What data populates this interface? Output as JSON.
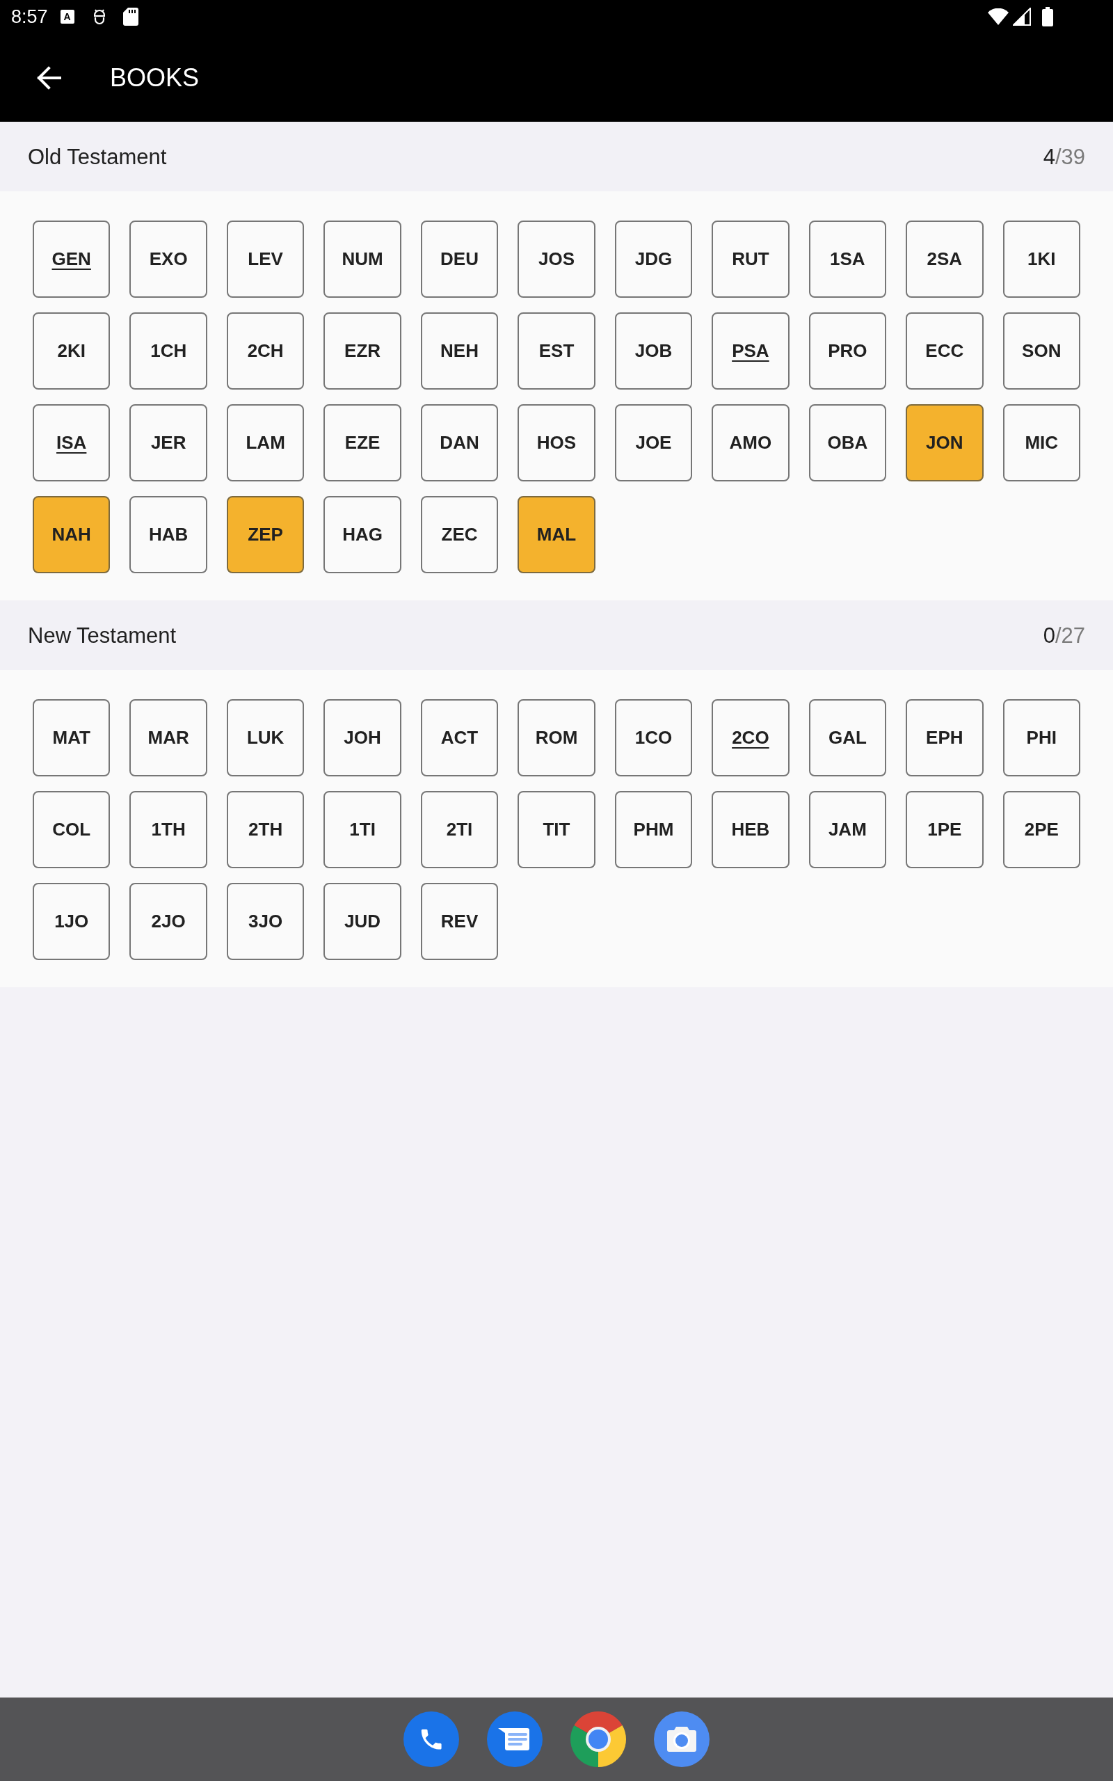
{
  "status_bar": {
    "time": "8:57",
    "badge_letter": "A"
  },
  "app_bar": {
    "title": "BOOKS"
  },
  "sections": [
    {
      "title": "Old Testament",
      "count": "4",
      "total": "/39",
      "books": [
        {
          "label": "GEN",
          "selected": false,
          "underlined": true
        },
        {
          "label": "EXO",
          "selected": false,
          "underlined": false
        },
        {
          "label": "LEV",
          "selected": false,
          "underlined": false
        },
        {
          "label": "NUM",
          "selected": false,
          "underlined": false
        },
        {
          "label": "DEU",
          "selected": false,
          "underlined": false
        },
        {
          "label": "JOS",
          "selected": false,
          "underlined": false
        },
        {
          "label": "JDG",
          "selected": false,
          "underlined": false
        },
        {
          "label": "RUT",
          "selected": false,
          "underlined": false
        },
        {
          "label": "1SA",
          "selected": false,
          "underlined": false
        },
        {
          "label": "2SA",
          "selected": false,
          "underlined": false
        },
        {
          "label": "1KI",
          "selected": false,
          "underlined": false
        },
        {
          "label": "2KI",
          "selected": false,
          "underlined": false
        },
        {
          "label": "1CH",
          "selected": false,
          "underlined": false
        },
        {
          "label": "2CH",
          "selected": false,
          "underlined": false
        },
        {
          "label": "EZR",
          "selected": false,
          "underlined": false
        },
        {
          "label": "NEH",
          "selected": false,
          "underlined": false
        },
        {
          "label": "EST",
          "selected": false,
          "underlined": false
        },
        {
          "label": "JOB",
          "selected": false,
          "underlined": false
        },
        {
          "label": "PSA",
          "selected": false,
          "underlined": true
        },
        {
          "label": "PRO",
          "selected": false,
          "underlined": false
        },
        {
          "label": "ECC",
          "selected": false,
          "underlined": false
        },
        {
          "label": "SON",
          "selected": false,
          "underlined": false
        },
        {
          "label": "ISA",
          "selected": false,
          "underlined": true
        },
        {
          "label": "JER",
          "selected": false,
          "underlined": false
        },
        {
          "label": "LAM",
          "selected": false,
          "underlined": false
        },
        {
          "label": "EZE",
          "selected": false,
          "underlined": false
        },
        {
          "label": "DAN",
          "selected": false,
          "underlined": false
        },
        {
          "label": "HOS",
          "selected": false,
          "underlined": false
        },
        {
          "label": "JOE",
          "selected": false,
          "underlined": false
        },
        {
          "label": "AMO",
          "selected": false,
          "underlined": false
        },
        {
          "label": "OBA",
          "selected": false,
          "underlined": false
        },
        {
          "label": "JON",
          "selected": true,
          "underlined": false
        },
        {
          "label": "MIC",
          "selected": false,
          "underlined": false
        },
        {
          "label": "NAH",
          "selected": true,
          "underlined": false
        },
        {
          "label": "HAB",
          "selected": false,
          "underlined": false
        },
        {
          "label": "ZEP",
          "selected": true,
          "underlined": false
        },
        {
          "label": "HAG",
          "selected": false,
          "underlined": false
        },
        {
          "label": "ZEC",
          "selected": false,
          "underlined": false
        },
        {
          "label": "MAL",
          "selected": true,
          "underlined": false
        }
      ]
    },
    {
      "title": "New Testament",
      "count": "0",
      "total": "/27",
      "books": [
        {
          "label": "MAT",
          "selected": false,
          "underlined": false
        },
        {
          "label": "MAR",
          "selected": false,
          "underlined": false
        },
        {
          "label": "LUK",
          "selected": false,
          "underlined": false
        },
        {
          "label": "JOH",
          "selected": false,
          "underlined": false
        },
        {
          "label": "ACT",
          "selected": false,
          "underlined": false
        },
        {
          "label": "ROM",
          "selected": false,
          "underlined": false
        },
        {
          "label": "1CO",
          "selected": false,
          "underlined": false
        },
        {
          "label": "2CO",
          "selected": false,
          "underlined": true
        },
        {
          "label": "GAL",
          "selected": false,
          "underlined": false
        },
        {
          "label": "EPH",
          "selected": false,
          "underlined": false
        },
        {
          "label": "PHI",
          "selected": false,
          "underlined": false
        },
        {
          "label": "COL",
          "selected": false,
          "underlined": false
        },
        {
          "label": "1TH",
          "selected": false,
          "underlined": false
        },
        {
          "label": "2TH",
          "selected": false,
          "underlined": false
        },
        {
          "label": "1TI",
          "selected": false,
          "underlined": false
        },
        {
          "label": "2TI",
          "selected": false,
          "underlined": false
        },
        {
          "label": "TIT",
          "selected": false,
          "underlined": false
        },
        {
          "label": "PHM",
          "selected": false,
          "underlined": false
        },
        {
          "label": "HEB",
          "selected": false,
          "underlined": false
        },
        {
          "label": "JAM",
          "selected": false,
          "underlined": false
        },
        {
          "label": "1PE",
          "selected": false,
          "underlined": false
        },
        {
          "label": "2PE",
          "selected": false,
          "underlined": false
        },
        {
          "label": "1JO",
          "selected": false,
          "underlined": false
        },
        {
          "label": "2JO",
          "selected": false,
          "underlined": false
        },
        {
          "label": "3JO",
          "selected": false,
          "underlined": false
        },
        {
          "label": "JUD",
          "selected": false,
          "underlined": false
        },
        {
          "label": "REV",
          "selected": false,
          "underlined": false
        }
      ]
    }
  ]
}
